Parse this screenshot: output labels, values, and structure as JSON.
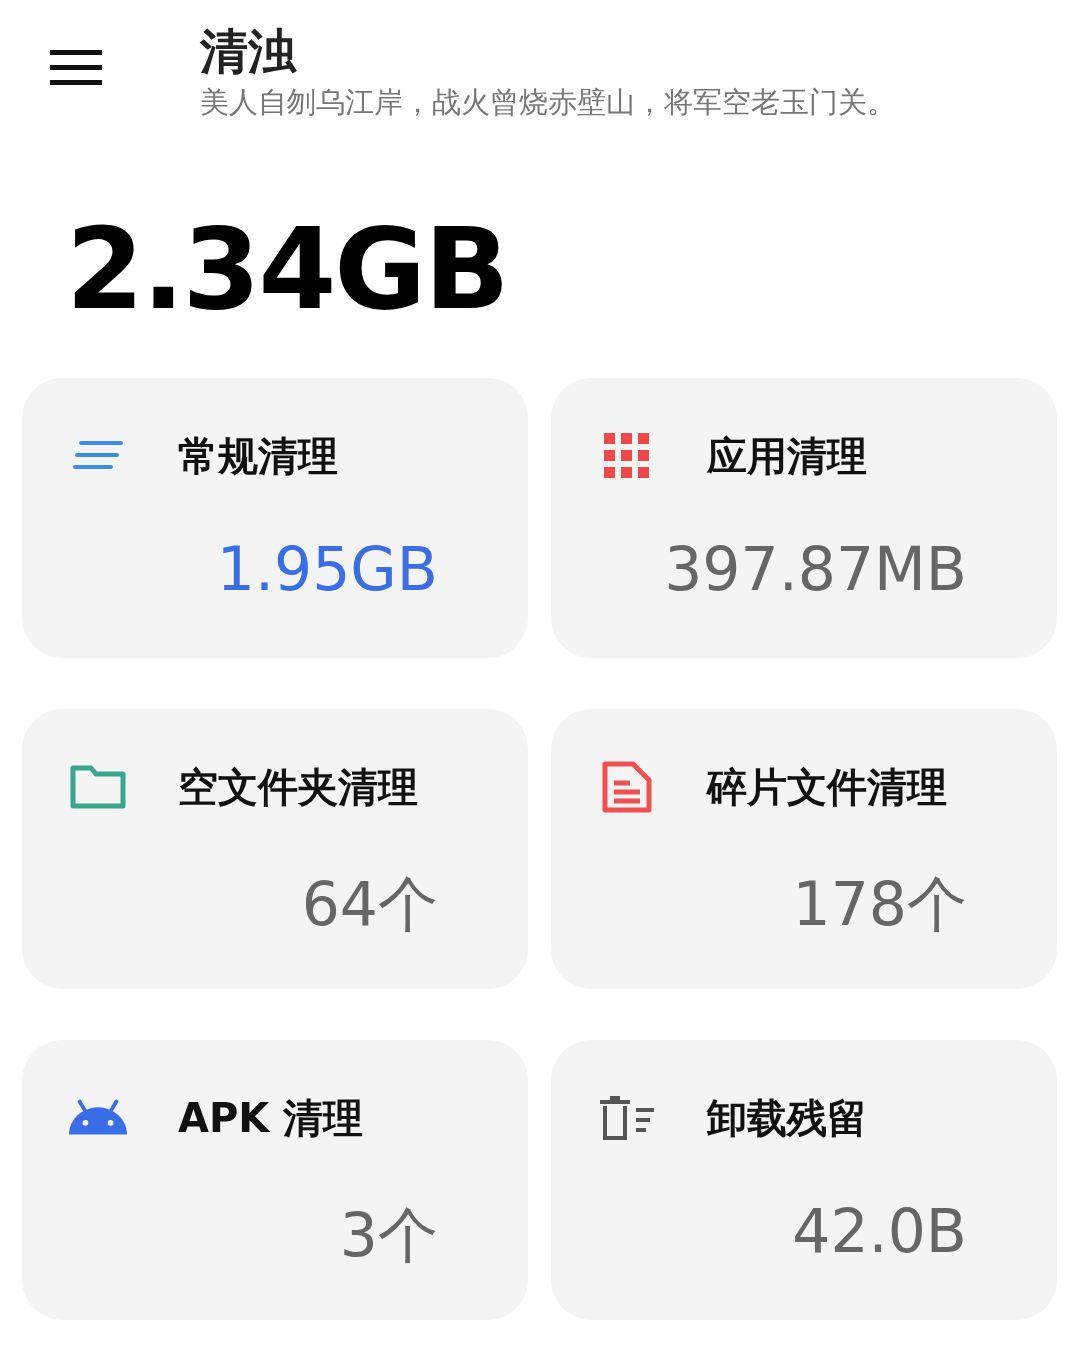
{
  "header": {
    "title": "清浊",
    "subtitle": "美人自刎乌江岸，战火曾烧赤壁山，将军空老玉门关。"
  },
  "total": "2.34GB",
  "cards": [
    {
      "kind": "general",
      "title": "常规清理",
      "value": "1.95GB",
      "highlight": true
    },
    {
      "kind": "apps",
      "title": "应用清理",
      "value": "397.87MB",
      "highlight": false
    },
    {
      "kind": "folder",
      "title": "空文件夹清理",
      "value": "64个",
      "highlight": false
    },
    {
      "kind": "fragment",
      "title": "碎片文件清理",
      "value": "178个",
      "highlight": false
    },
    {
      "kind": "apk",
      "title": "APK 清理",
      "value": "3个",
      "highlight": false
    },
    {
      "kind": "residue",
      "title": "卸载残留",
      "value": "42.0B",
      "highlight": false
    }
  ]
}
